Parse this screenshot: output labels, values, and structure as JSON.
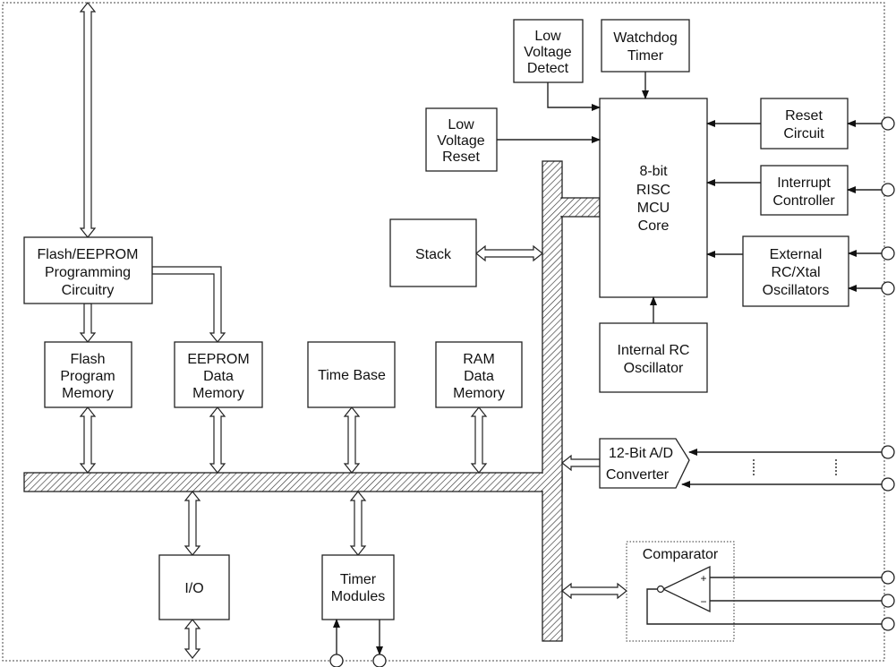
{
  "blocks": {
    "prog": [
      "Flash/EEPROM",
      "Programming",
      "Circuitry"
    ],
    "flash": [
      "Flash",
      "Program",
      "Memory"
    ],
    "eeprom": [
      "EEPROM",
      "Data",
      "Memory"
    ],
    "timebase": [
      "Time Base"
    ],
    "ram": [
      "RAM",
      "Data",
      "Memory"
    ],
    "lvd": [
      "Low",
      "Voltage",
      "Detect"
    ],
    "wdt": [
      "Watchdog",
      "Timer"
    ],
    "lvr": [
      "Low",
      "Voltage",
      "Reset"
    ],
    "mcu": [
      "8-bit",
      "RISC",
      "MCU",
      "Core"
    ],
    "reset": [
      "Reset",
      "Circuit"
    ],
    "irq": [
      "Interrupt",
      "Controller"
    ],
    "ext": [
      "External",
      "RC/Xtal",
      "Oscillators"
    ],
    "stack": [
      "Stack"
    ],
    "irc": [
      "Internal RC",
      "Oscillator"
    ],
    "adc": [
      "12-Bit A/D",
      "Converter"
    ],
    "comp": [
      "Comparator"
    ],
    "io": [
      "I/O"
    ],
    "timer": [
      "Timer",
      "Modules"
    ],
    "comp_plus": "+",
    "comp_minus": "−"
  },
  "colors": {
    "line": "#222222",
    "background": "#ffffff"
  }
}
